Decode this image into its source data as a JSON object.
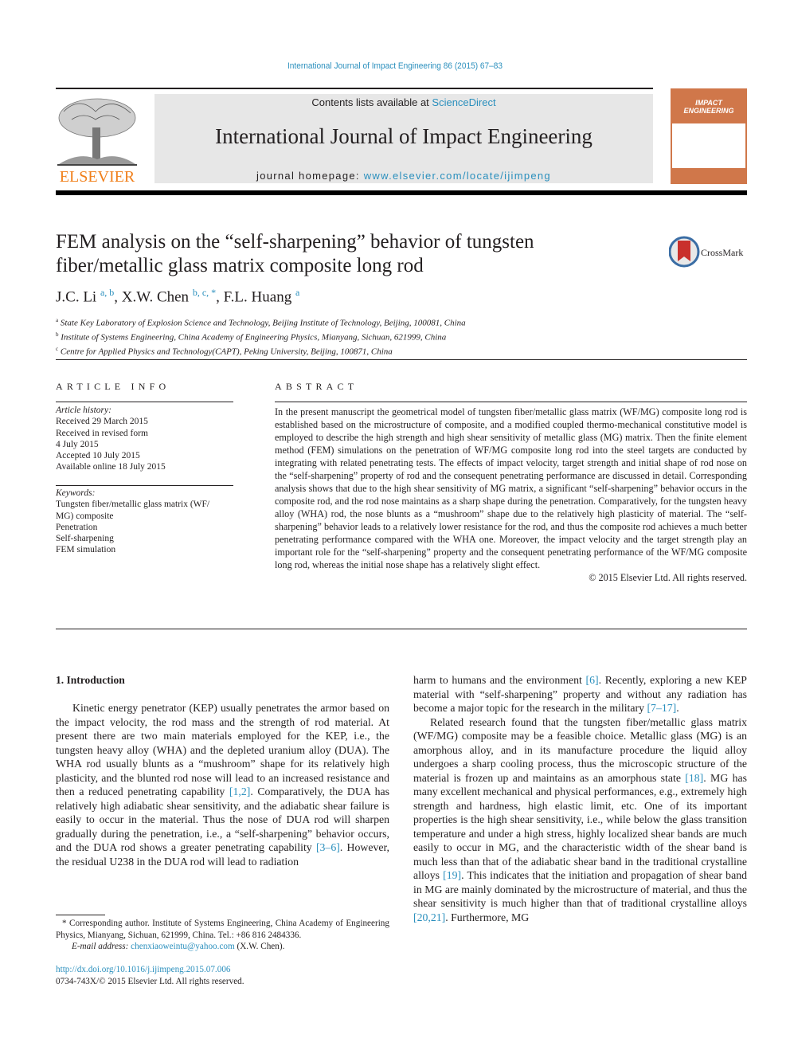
{
  "header": {
    "journal_ref": "International Journal of Impact Engineering 86 (2015) 67–83",
    "contents_prefix": "Contents lists available at ",
    "contents_link": "ScienceDirect",
    "journal_title": "International Journal of Impact Engineering",
    "homepage_prefix": "journal homepage: ",
    "homepage_link": "www.elsevier.com/locate/ijimpeng",
    "publisher_logo_text": "ELSEVIER",
    "cover_title": "IMPACT ENGINEERING",
    "crossmark_label": "CrossMark",
    "colors": {
      "link": "#2a8fbd",
      "elsevier_orange": "#f07f1a",
      "cover": "#d0774a"
    }
  },
  "article": {
    "title": "FEM analysis on the “self-sharpening” behavior of tungsten fiber/metallic glass matrix composite long rod",
    "authors": [
      {
        "name": "J.C. Li",
        "marks": "a, b"
      },
      {
        "name": "X.W. Chen",
        "marks": "b, c, *"
      },
      {
        "name": "F.L. Huang",
        "marks": "a"
      }
    ],
    "affiliations": [
      {
        "mark": "a",
        "text": "State Key Laboratory of Explosion Science and Technology, Beijing Institute of Technology, Beijing, 100081, China"
      },
      {
        "mark": "b",
        "text": "Institute of Systems Engineering, China Academy of Engineering Physics, Mianyang, Sichuan, 621999, China"
      },
      {
        "mark": "c",
        "text": "Centre for Applied Physics and Technology(CAPT), Peking University, Beijing, 100871, China"
      }
    ]
  },
  "article_info": {
    "heading": "ARTICLE INFO",
    "history_label": "Article history:",
    "history": [
      "Received 29 March 2015",
      "Received in revised form",
      "4 July 2015",
      "Accepted 10 July 2015",
      "Available online 18 July 2015"
    ],
    "keywords_label": "Keywords:",
    "keywords": [
      "Tungsten fiber/metallic glass matrix (WF/",
      "MG) composite",
      "Penetration",
      "Self-sharpening",
      "FEM simulation"
    ]
  },
  "abstract": {
    "heading": "ABSTRACT",
    "text": "In the present manuscript the geometrical model of tungsten fiber/metallic glass matrix (WF/MG) composite long rod is established based on the microstructure of composite, and a modified coupled thermo-mechanical constitutive model is employed to describe the high strength and high shear sensitivity of metallic glass (MG) matrix. Then the finite element method (FEM) simulations on the penetration of WF/MG composite long rod into the steel targets are conducted by integrating with related penetrating tests. The effects of impact velocity, target strength and initial shape of rod nose on the “self-sharpening” property of rod and the consequent penetrating performance are discussed in detail. Corresponding analysis shows that due to the high shear sensitivity of MG matrix, a significant “self-sharpening” behavior occurs in the composite rod, and the rod nose maintains as a sharp shape during the penetration. Comparatively, for the tungsten heavy alloy (WHA) rod, the nose blunts as a “mushroom” shape due to the relatively high plasticity of material. The “self-sharpening” behavior leads to a relatively lower resistance for the rod, and thus the composite rod achieves a much better penetrating performance compared with the WHA one. Moreover, the impact velocity and the target strength play an important role for the “self-sharpening” property and the consequent penetrating performance of the WF/MG composite long rod, whereas the initial nose shape has a relatively slight effect.",
    "copyright": "© 2015 Elsevier Ltd. All rights reserved."
  },
  "body": {
    "section_heading": "1.  Introduction",
    "col1": {
      "p1_a": "Kinetic energy penetrator (KEP) usually penetrates the armor based on the impact velocity, the rod mass and the strength of rod material. At present there are two main materials employed for the KEP, i.e., the tungsten heavy alloy (WHA) and the depleted uranium alloy (DUA). The WHA rod usually blunts as a “mushroom” shape for its relatively high plasticity, and the blunted rod nose will lead to an increased resistance and then a reduced penetrating capability ",
      "ref1": "[1,2]",
      "p1_b": ". Comparatively, the DUA has relatively high adiabatic shear sensitivity, and the adiabatic shear failure is easily to occur in the material. Thus the nose of DUA rod will sharpen gradually during the penetration, i.e., a “self-sharpening” behavior occurs, and the DUA rod shows a greater penetrating capability ",
      "ref2": "[3–6]",
      "p1_c": ". However, the residual U238 in the DUA rod will lead to radiation"
    },
    "col2": {
      "p1_a": "harm to humans and the environment ",
      "ref1": "[6]",
      "p1_b": ". Recently, exploring a new KEP material with “self-sharpening” property and without any radiation has become a major topic for the research in the military ",
      "ref2": "[7–17]",
      "p1_c": ".",
      "p2_a": "Related research found that the tungsten fiber/metallic glass matrix (WF/MG) composite may be a feasible choice. Metallic glass (MG) is an amorphous alloy, and in its manufacture procedure the liquid alloy undergoes a sharp cooling process, thus the microscopic structure of the material is frozen up and maintains as an amorphous state ",
      "ref3": "[18]",
      "p2_b": ". MG has many excellent mechanical and physical performances, e.g., extremely high strength and hardness, high elastic limit, etc. One of its important properties is the high shear sensitivity, i.e., while below the glass transition temperature and under a high stress, highly localized shear bands are much easily to occur in MG, and the characteristic width of the shear band is much less than that of the adiabatic shear band in the traditional crystalline alloys ",
      "ref4": "[19]",
      "p2_c": ". This indicates that the initiation and propagation of shear band in MG are mainly dominated by the microstructure of material, and thus the shear sensitivity is much higher than that of traditional crystalline alloys ",
      "ref5": "[20,21]",
      "p2_d": ". Furthermore, MG"
    }
  },
  "footnote": {
    "corresponding": "* Corresponding author. Institute of Systems Engineering, China Academy of Engineering Physics, Mianyang, Sichuan, 621999, China. Tel.: +86 816 2484336.",
    "email_label": "E-mail address: ",
    "email": "chenxiaoweintu@yahoo.com",
    "email_suffix": " (X.W. Chen).",
    "doi": "http://dx.doi.org/10.1016/j.ijimpeng.2015.07.006",
    "issn": "0734-743X/© 2015 Elsevier Ltd. All rights reserved."
  }
}
